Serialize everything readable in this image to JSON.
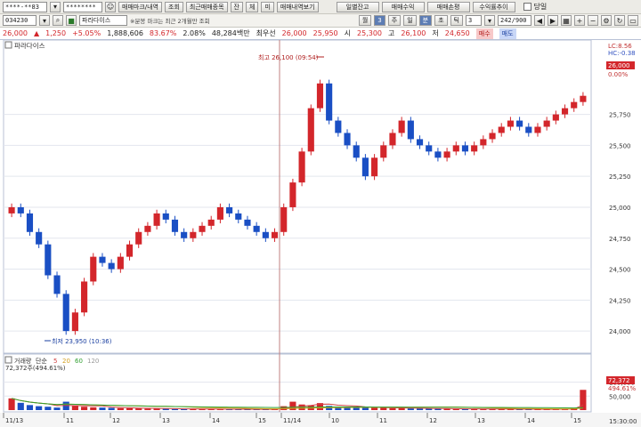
{
  "toolbar": {
    "account": "****-**83",
    "password": "********",
    "tabs": [
      "매매마크/내역",
      "조회",
      "최근매매종목",
      "잔",
      "체",
      "미",
      "매매내역보기"
    ],
    "right_buttons": [
      "일별잔고",
      "매매수익",
      "매매손평",
      "수익률추이"
    ],
    "today_label": "당일"
  },
  "row2": {
    "code": "034230",
    "stock_name": "파라다이스",
    "notice": "※분봉 마크는 최근 2개월만 조회",
    "period_buttons": [
      "월",
      "3",
      "주",
      "일",
      "분",
      "초",
      "틱"
    ],
    "interval_value": "3",
    "count": "242/900"
  },
  "quote": {
    "price": "26,000",
    "change": "1,250",
    "change_pct": "+5.05%",
    "volume": "1,888,606",
    "vol_ratio": "83.67%",
    "turnover_ratio": "2.08%",
    "amount": "48,284백만",
    "priority_label": "최우선",
    "ask": "26,000",
    "bid": "25,950",
    "open_label": "시",
    "open": "25,300",
    "high_label": "고",
    "high": "26,100",
    "low_label": "저",
    "low": "24,650",
    "buy_label": "매수",
    "sell_label": "매도"
  },
  "price_panel": {
    "title": "파라다이스",
    "lc_label": "LC:8.56",
    "hc_label": "HC:-0.38",
    "current_price_label": "26,000",
    "current_pct_label": "0.00%",
    "high_annotation": "최고 26,100 (09:54)",
    "low_annotation": "최저 23,950 (10:36)"
  },
  "volume_panel": {
    "title": "거래량",
    "ma_label": "단순",
    "ma_periods": [
      "5",
      "20",
      "60",
      "120"
    ],
    "info": "72,372주(494.61%)",
    "current_label": "72,372",
    "current_pct": "494.61%"
  },
  "axis": {
    "x_labels": [
      "11/13",
      "11",
      "12",
      "13",
      "14",
      "15",
      "11/14",
      "10",
      "11",
      "12",
      "13",
      "14",
      "15"
    ],
    "time_label": "15:30:00"
  },
  "chart_data": {
    "type": "candlestick",
    "title": "파라다이스",
    "price_ticks": [
      24000,
      24250,
      24500,
      24750,
      25000,
      25250,
      25500,
      25750
    ],
    "price_range": [
      23850,
      26250
    ],
    "volume_ticks": [
      50000,
      100000
    ],
    "volume_range": [
      0,
      140000
    ],
    "closes": [
      25000,
      24950,
      24800,
      24700,
      24450,
      24300,
      24000,
      24150,
      24400,
      24600,
      24550,
      24500,
      24600,
      24700,
      24800,
      24850,
      24950,
      24900,
      24800,
      24750,
      24800,
      24850,
      24900,
      25000,
      24950,
      24900,
      24850,
      24800,
      24750,
      24800,
      25000,
      25200,
      25450,
      25800,
      26000,
      25700,
      25600,
      25500,
      25400,
      25250,
      25400,
      25500,
      25600,
      25700,
      25550,
      25500,
      25450,
      25400,
      25450,
      25500,
      25450,
      25500,
      25550,
      25600,
      25650,
      25700,
      25650,
      25600,
      25650,
      25700,
      25750,
      25800,
      25850,
      25900
    ],
    "volume_values": [
      42000,
      26000,
      18000,
      14000,
      12000,
      9000,
      30000,
      15000,
      12000,
      10000,
      9000,
      8000,
      7000,
      7000,
      6000,
      5000,
      5000,
      5000,
      4000,
      4000,
      3500,
      3500,
      3500,
      3000,
      3000,
      3000,
      3000,
      3000,
      3000,
      3000,
      14000,
      30000,
      20000,
      16000,
      25000,
      15000,
      12000,
      11000,
      10000,
      9000,
      8000,
      8000,
      7000,
      7000,
      6000,
      6000,
      5000,
      5000,
      5000,
      4000,
      4000,
      4000,
      3500,
      3500,
      3500,
      3000,
      3000,
      3000,
      3000,
      3000,
      3000,
      4000,
      8000,
      72372
    ]
  },
  "colors": {
    "up": "#d3262b",
    "down": "#1a4fc4",
    "ma5": "#d04040",
    "ma20": "#d4a020",
    "ma60": "#30a030",
    "ma120": "#9a9a9a"
  }
}
